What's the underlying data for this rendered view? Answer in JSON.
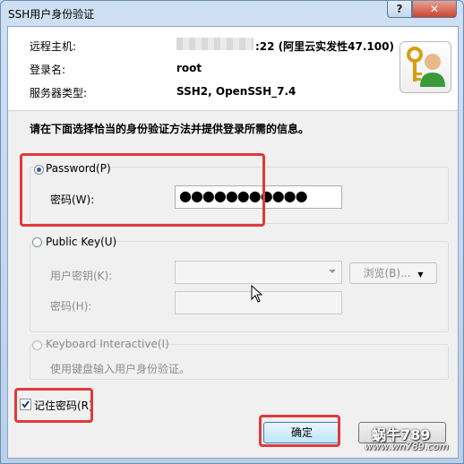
{
  "window": {
    "title": "SSH用户身份验证",
    "help_label": "?",
    "close_label": "✕"
  },
  "info": {
    "host_label": "远程主机:",
    "host_suffix": ":22 (阿里云实发性47.100)",
    "user_label": "登录名:",
    "user_value": "root",
    "server_label": "服务器类型:",
    "server_value": "SSH2, OpenSSH_7.4",
    "icon": "key-user-icon"
  },
  "instruction": "请在下面选择恰当的身份验证方法并提供登录所需的信息。",
  "password_group": {
    "label": "Password(P)",
    "checked": true,
    "field_label": "密码(W):",
    "value": "●●●●●●●●●●●"
  },
  "publickey_group": {
    "label": "Public Key(U)",
    "checked": false,
    "key_label": "用户密钥(K):",
    "browse_label": "浏览(B)...",
    "passphrase_label": "密码(H):"
  },
  "keyboard_group": {
    "label": "Keyboard Interactive(I)",
    "desc": "使用键盘输入用户身份验证。"
  },
  "remember": {
    "label": "记住密码(R)",
    "checked": true
  },
  "buttons": {
    "ok": "确定"
  },
  "watermark": {
    "brand": "蜗牛789",
    "domain": "www.wn789.com"
  },
  "colors": {
    "highlight": "#e0393b",
    "accent": "#2b5aa8"
  }
}
